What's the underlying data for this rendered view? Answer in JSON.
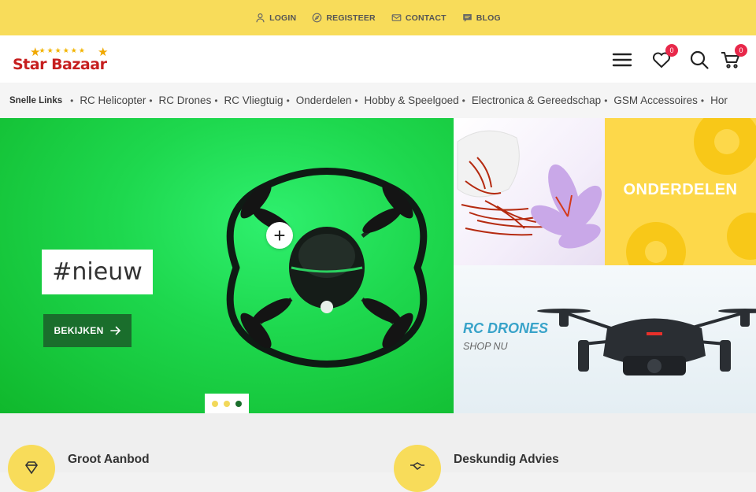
{
  "topbar": {
    "links": [
      {
        "label": "LOGIN",
        "icon": "user-icon"
      },
      {
        "label": "REGISTEER",
        "icon": "compass-icon"
      },
      {
        "label": "CONTACT",
        "icon": "envelope-icon"
      },
      {
        "label": "BLOG",
        "icon": "chat-icon"
      }
    ],
    "background": "#f8dc5a"
  },
  "header": {
    "logo_text": "Star Bazaar",
    "wishlist_count": "0",
    "cart_count": "0",
    "badge_color": "#e8284a"
  },
  "quicklinks": {
    "title": "Snelle Links",
    "items": [
      "RC Helicopter",
      "RC Drones",
      "RC Vliegtuig",
      "Onderdelen",
      "Hobby & Speelgoed",
      "Electronica & Gereedschap",
      "GSM Accessoires",
      "Hor"
    ]
  },
  "hero": {
    "tag": "#nieuw",
    "button_label": "BEKIJKEN",
    "slides": 3,
    "active_slide": 3,
    "accent": "#1a6e2c"
  },
  "tiles": {
    "parts_label": "ONDERDELEN",
    "drones_label": "RC DRONES",
    "drones_sub": "SHOP NU"
  },
  "features": [
    {
      "title": "Groot Aanbod",
      "icon": "diamond-icon"
    },
    {
      "title": "Deskundig Advies",
      "icon": "handshake-icon"
    }
  ]
}
